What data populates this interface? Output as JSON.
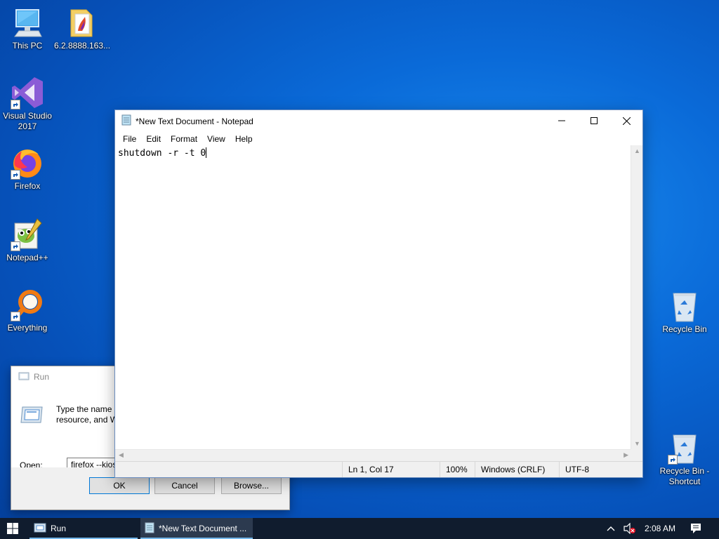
{
  "desktop": {
    "icons": [
      {
        "label": "This PC",
        "name": "this-pc-icon"
      },
      {
        "label": "6.2.8888.163...",
        "name": "folder-icon"
      },
      {
        "label": "Visual Studio 2017",
        "name": "visual-studio-icon"
      },
      {
        "label": "Firefox",
        "name": "firefox-icon"
      },
      {
        "label": "Notepad++",
        "name": "notepadpp-icon"
      },
      {
        "label": "Everything",
        "name": "everything-icon"
      },
      {
        "label": "Recycle Bin",
        "name": "recycle-bin-icon"
      },
      {
        "label": "Recycle Bin - Shortcut",
        "name": "recycle-bin-shortcut-icon"
      }
    ]
  },
  "run_dialog": {
    "title": "Run",
    "description_line1": "Type the name o",
    "description_line2": "resource, and W",
    "open_label": "Open:",
    "input_value": "firefox --kiosk",
    "ok_label": "OK",
    "cancel_label": "Cancel",
    "browse_label": "Browse..."
  },
  "notepad": {
    "title": "*New Text Document - Notepad",
    "menu": [
      "File",
      "Edit",
      "Format",
      "View",
      "Help"
    ],
    "content": "shutdown -r -t 0",
    "status": {
      "position": "Ln 1, Col 17",
      "zoom": "100%",
      "line_ending": "Windows (CRLF)",
      "encoding": "UTF-8"
    }
  },
  "taskbar": {
    "items": [
      {
        "label": "Run",
        "active": false
      },
      {
        "label": "*New Text Document ...",
        "active": true
      }
    ],
    "clock": "2:08 AM"
  },
  "colors": {
    "desktop_blue": "#0a6ad8",
    "taskbar": "#101c2e",
    "taskbar_accent": "#76b9ed"
  }
}
